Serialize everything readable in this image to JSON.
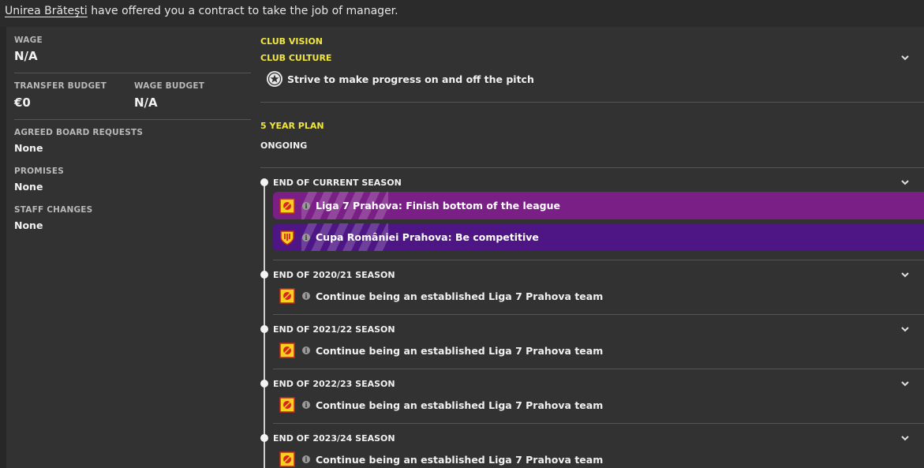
{
  "offer": {
    "club_name": "Unirea Brăteşti",
    "message_rest": " have offered you a contract to take the job of manager."
  },
  "contract": {
    "wage_label": "WAGE",
    "wage_value": "N/A",
    "transfer_budget_label": "TRANSFER BUDGET",
    "transfer_budget_value": "€0",
    "wage_budget_label": "WAGE BUDGET",
    "wage_budget_value": "N/A",
    "agreed_label": "AGREED BOARD REQUESTS",
    "agreed_value": "None",
    "promises_label": "PROMISES",
    "promises_value": "None",
    "staff_label": "STAFF CHANGES",
    "staff_value": "None"
  },
  "vision": {
    "title": "CLUB VISION",
    "culture_title": "CLUB CULTURE",
    "culture_text": "Strive to make progress on and off the pitch",
    "plan_title": "5 YEAR PLAN",
    "plan_status": "ONGOING"
  },
  "seasons": [
    {
      "label": "END OF CURRENT SEASON",
      "objectives": [
        {
          "text": "Liga 7 Prahova: Finish bottom of the league",
          "color": "#7a1f86",
          "icon": "league-badge-icon"
        },
        {
          "text": "Cupa României Prahova: Be competitive",
          "color": "#4e1585",
          "icon": "cup-badge-icon"
        }
      ]
    },
    {
      "label": "END OF 2020/21 SEASON",
      "objectives": [
        {
          "text": "Continue being an established Liga 7 Prahova team",
          "icon": "league-badge-icon"
        }
      ]
    },
    {
      "label": "END OF 2021/22 SEASON",
      "objectives": [
        {
          "text": "Continue being an established Liga 7 Prahova team",
          "icon": "league-badge-icon"
        }
      ]
    },
    {
      "label": "END OF 2022/23 SEASON",
      "objectives": [
        {
          "text": "Continue being an established Liga 7 Prahova team",
          "icon": "league-badge-icon"
        }
      ]
    },
    {
      "label": "END OF 2023/24 SEASON",
      "objectives": [
        {
          "text": "Continue being an established Liga 7 Prahova team",
          "icon": "league-badge-icon"
        }
      ]
    }
  ],
  "colors": {
    "accent_yellow": "#f0e640",
    "panel_bg": "#323232",
    "page_bg": "#272727"
  }
}
